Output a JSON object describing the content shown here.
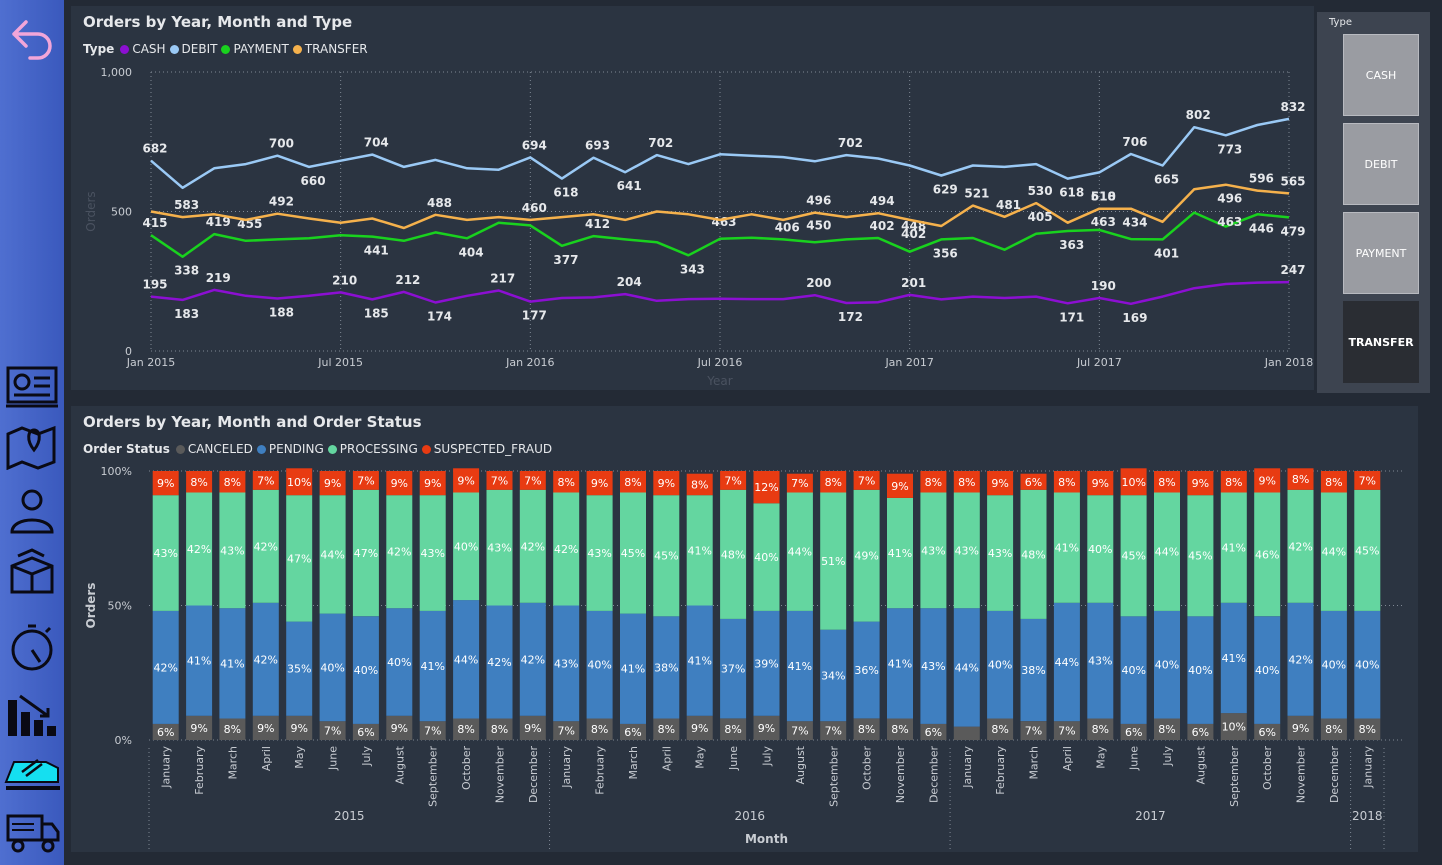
{
  "colors": {
    "cash": "#8c0fd2",
    "debit": "#9ac9f5",
    "payment": "#19d21e",
    "transfer": "#f5b14c",
    "canceled": "#5a5a5a",
    "pending": "#3f7fc0",
    "processing": "#64d6a0",
    "fraud": "#e83b12"
  },
  "nav": {
    "icons": [
      "back-arrow-icon",
      "dashboard-icon",
      "map-icon",
      "user-icon",
      "box-icon",
      "stopwatch-icon",
      "bar-chart-down-icon",
      "delivery-van-icon",
      "truck-icon"
    ]
  },
  "slicer": {
    "title": "Type",
    "items": [
      "CASH",
      "DEBIT",
      "PAYMENT",
      "TRANSFER"
    ],
    "selected": "TRANSFER"
  },
  "chart_data": [
    {
      "type": "line",
      "title": "Orders by Year, Month and Type",
      "legend_title": "Type",
      "xlabel": "Year",
      "ylabel": "Orders",
      "ylim": [
        0,
        1000
      ],
      "yticks": [
        "0",
        "500",
        "1,000"
      ],
      "x_tick_labels": [
        "Jan 2015",
        "Jul 2015",
        "Jan 2016",
        "Jul 2016",
        "Jan 2017",
        "Jul 2017",
        "Jan 2018"
      ],
      "x": [
        "Jan 2015",
        "Feb 2015",
        "Mar 2015",
        "Apr 2015",
        "May 2015",
        "Jun 2015",
        "Jul 2015",
        "Aug 2015",
        "Sep 2015",
        "Oct 2015",
        "Nov 2015",
        "Dec 2015",
        "Jan 2016",
        "Feb 2016",
        "Mar 2016",
        "Apr 2016",
        "May 2016",
        "Jun 2016",
        "Jul 2016",
        "Aug 2016",
        "Sep 2016",
        "Oct 2016",
        "Nov 2016",
        "Dec 2016",
        "Jan 2017",
        "Feb 2017",
        "Mar 2017",
        "Apr 2017",
        "May 2017",
        "Jun 2017",
        "Jul 2017",
        "Aug 2017",
        "Sep 2017",
        "Oct 2017",
        "Nov 2017",
        "Dec 2017",
        "Jan 2018"
      ],
      "series": [
        {
          "name": "CASH",
          "key": "cash",
          "values": [
            195,
            183,
            219,
            198,
            188,
            198,
            210,
            185,
            212,
            174,
            198,
            217,
            177,
            190,
            192,
            204,
            180,
            186,
            187,
            186,
            186,
            200,
            172,
            175,
            201,
            185,
            195,
            190,
            195,
            171,
            190,
            169,
            195,
            225,
            240,
            245,
            247
          ],
          "labels": [
            [
              0,
              195,
              "above"
            ],
            [
              1,
              183,
              "below"
            ],
            [
              2,
              219,
              "above"
            ],
            [
              4,
              188,
              "below"
            ],
            [
              6,
              210,
              "above"
            ],
            [
              7,
              185,
              "below"
            ],
            [
              8,
              212,
              "above"
            ],
            [
              9,
              174,
              "below"
            ],
            [
              11,
              217,
              "above"
            ],
            [
              12,
              177,
              "below"
            ],
            [
              15,
              204,
              "above"
            ],
            [
              21,
              200,
              "above"
            ],
            [
              22,
              172,
              "below"
            ],
            [
              24,
              201,
              "above"
            ],
            [
              29,
              171,
              "below"
            ],
            [
              30,
              190,
              "above"
            ],
            [
              31,
              169,
              "below"
            ],
            [
              36,
              247,
              "above"
            ]
          ]
        },
        {
          "name": "DEBIT",
          "key": "debit",
          "values": [
            682,
            585,
            655,
            670,
            700,
            660,
            682,
            704,
            660,
            685,
            655,
            650,
            694,
            618,
            693,
            641,
            702,
            670,
            705,
            700,
            695,
            680,
            702,
            690,
            665,
            629,
            665,
            660,
            670,
            618,
            640,
            706,
            665,
            802,
            773,
            810,
            832
          ],
          "labels": [
            [
              0,
              682,
              "above"
            ],
            [
              4,
              700,
              "above"
            ],
            [
              5,
              660,
              "below"
            ],
            [
              7,
              704,
              "above"
            ],
            [
              12,
              694,
              "above"
            ],
            [
              13,
              618,
              "below"
            ],
            [
              14,
              693,
              "above"
            ],
            [
              15,
              641,
              "below"
            ],
            [
              16,
              702,
              "above"
            ],
            [
              22,
              702,
              "above"
            ],
            [
              25,
              629,
              "below"
            ],
            [
              29,
              618,
              "below"
            ],
            [
              31,
              706,
              "above"
            ],
            [
              32,
              665,
              "below"
            ],
            [
              33,
              802,
              "above"
            ],
            [
              34,
              773,
              "below"
            ],
            [
              36,
              832,
              "above"
            ]
          ]
        },
        {
          "name": "PAYMENT",
          "key": "payment",
          "values": [
            415,
            338,
            419,
            395,
            400,
            404,
            415,
            410,
            395,
            425,
            404,
            460,
            450,
            377,
            412,
            400,
            390,
            343,
            402,
            406,
            400,
            390,
            400,
            405,
            356,
            400,
            405,
            363,
            420,
            430,
            434,
            401,
            400,
            496,
            446,
            490,
            479
          ],
          "labels": [
            [
              0,
              415,
              "above"
            ],
            [
              1,
              338,
              "below"
            ],
            [
              2,
              419,
              "above"
            ],
            [
              3,
              455,
              "tag"
            ],
            [
              7,
              441,
              "below"
            ],
            [
              10,
              404,
              "below"
            ],
            [
              13,
              377,
              "below"
            ],
            [
              14,
              412,
              "above"
            ],
            [
              17,
              343,
              "below"
            ],
            [
              18,
              463,
              "tag"
            ],
            [
              20,
              406,
              "above"
            ],
            [
              21,
              450,
              "tag"
            ],
            [
              23,
              402,
              "above"
            ],
            [
              24,
              448,
              "tag"
            ],
            [
              25,
              356,
              "below"
            ],
            [
              29,
              363,
              "below"
            ],
            [
              30,
              463,
              "tag"
            ],
            [
              32,
              401,
              "below"
            ],
            [
              34,
              463,
              "tag"
            ],
            [
              35,
              446,
              "below"
            ],
            [
              36,
              479,
              "below"
            ]
          ]
        },
        {
          "name": "TRANSFER",
          "key": "transfer",
          "values": [
            500,
            480,
            490,
            470,
            492,
            475,
            460,
            475,
            441,
            488,
            470,
            480,
            470,
            480,
            490,
            470,
            500,
            490,
            470,
            490,
            470,
            496,
            480,
            494,
            470,
            448,
            521,
            481,
            530,
            460,
            510,
            510,
            463,
            580,
            596,
            575,
            565
          ],
          "labels": [
            [
              1,
              583,
              "above"
            ],
            [
              4,
              492,
              "above"
            ],
            [
              9,
              488,
              "above"
            ],
            [
              12,
              460,
              "above"
            ],
            [
              27,
              481,
              "above"
            ],
            [
              28,
              405,
              "below"
            ],
            [
              28,
              530,
              "above"
            ],
            [
              30,
              618,
              "above"
            ],
            [
              30,
              510,
              "above"
            ],
            [
              31,
              434,
              "below"
            ],
            [
              21,
              496,
              "above"
            ],
            [
              23,
              494,
              "above"
            ],
            [
              24,
              402,
              "below"
            ],
            [
              26,
              521,
              "above"
            ],
            [
              34,
              496,
              "below"
            ],
            [
              35,
              596,
              "above"
            ],
            [
              36,
              565,
              "above"
            ]
          ]
        }
      ]
    },
    {
      "type": "bar",
      "stacked": "100%",
      "title": "Orders by Year, Month and Order Status",
      "legend_title": "Order Status",
      "xlabel": "Month",
      "ylabel": "Orders",
      "yticks": [
        "0%",
        "50%",
        "100%"
      ],
      "categories": [
        "January",
        "February",
        "March",
        "April",
        "May",
        "June",
        "July",
        "August",
        "September",
        "October",
        "November",
        "December",
        "January",
        "February",
        "March",
        "April",
        "May",
        "June",
        "July",
        "August",
        "September",
        "October",
        "November",
        "December",
        "January",
        "February",
        "March",
        "April",
        "May",
        "June",
        "July",
        "August",
        "September",
        "October",
        "November",
        "December",
        "January"
      ],
      "years": [
        {
          "label": "2015",
          "start": 0,
          "end": 11
        },
        {
          "label": "2016",
          "start": 12,
          "end": 23
        },
        {
          "label": "2017",
          "start": 24,
          "end": 35
        },
        {
          "label": "2018",
          "start": 36,
          "end": 36
        }
      ],
      "series": [
        {
          "name": "CANCELED",
          "key": "canceled",
          "values": [
            6,
            9,
            8,
            9,
            9,
            7,
            6,
            9,
            7,
            8,
            8,
            9,
            7,
            8,
            6,
            8,
            9,
            8,
            9,
            7,
            7,
            8,
            8,
            6,
            5,
            8,
            7,
            7,
            8,
            6,
            8,
            6,
            10,
            6,
            9,
            8,
            8
          ],
          "show_labels": [
            1,
            1,
            1,
            1,
            1,
            1,
            1,
            1,
            1,
            1,
            1,
            1,
            1,
            1,
            1,
            1,
            1,
            1,
            1,
            1,
            1,
            1,
            1,
            1,
            0,
            1,
            1,
            1,
            1,
            1,
            1,
            1,
            1,
            1,
            1,
            1,
            1
          ]
        },
        {
          "name": "PENDING",
          "key": "pending",
          "values": [
            42,
            41,
            41,
            42,
            35,
            40,
            40,
            40,
            41,
            44,
            42,
            42,
            43,
            40,
            41,
            38,
            41,
            37,
            39,
            41,
            34,
            36,
            41,
            43,
            44,
            40,
            38,
            44,
            43,
            40,
            40,
            40,
            41,
            40,
            42,
            40,
            40
          ]
        },
        {
          "name": "PROCESSING",
          "key": "processing",
          "values": [
            43,
            42,
            43,
            42,
            47,
            44,
            47,
            42,
            43,
            40,
            43,
            42,
            42,
            43,
            45,
            45,
            41,
            48,
            40,
            44,
            51,
            49,
            41,
            43,
            43,
            43,
            48,
            41,
            40,
            45,
            44,
            45,
            41,
            46,
            42,
            44,
            45
          ]
        },
        {
          "name": "SUSPECTED_FRAUD",
          "key": "fraud",
          "values": [
            9,
            8,
            8,
            7,
            10,
            9,
            7,
            9,
            9,
            9,
            7,
            7,
            8,
            9,
            8,
            9,
            8,
            7,
            12,
            7,
            8,
            7,
            9,
            8,
            8,
            9,
            6,
            8,
            9,
            10,
            8,
            9,
            8,
            9,
            8,
            8,
            7
          ]
        }
      ]
    }
  ]
}
